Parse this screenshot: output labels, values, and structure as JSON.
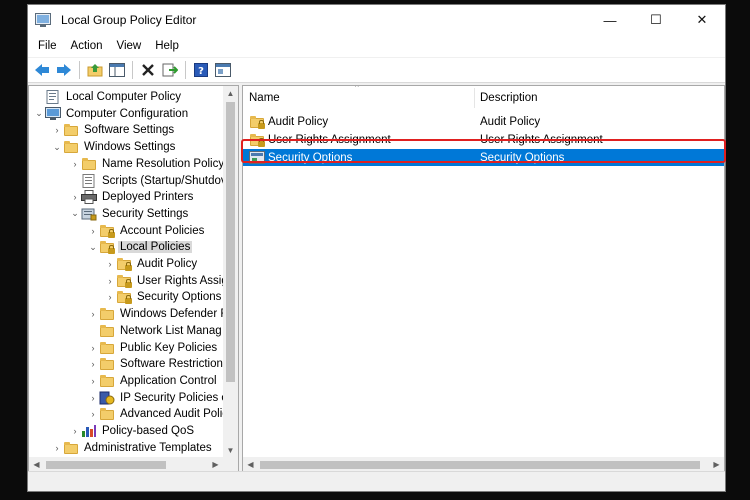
{
  "window": {
    "title": "Local Group Policy Editor",
    "controls": {
      "minimize": "—",
      "maximize": "☐",
      "close": "✕"
    }
  },
  "menu": [
    "File",
    "Action",
    "View",
    "Help"
  ],
  "toolbar": [
    "back-icon",
    "forward-icon",
    "up-folder-icon",
    "show-tree-icon",
    "delete-icon",
    "export-icon",
    "help-icon",
    "properties-icon"
  ],
  "tree": [
    {
      "label": "Local Computer Policy",
      "icon": "computer-policy-icon",
      "expander": ""
    },
    {
      "label": "Computer Configuration",
      "icon": "computer-icon",
      "expander": "⌄"
    },
    {
      "label": "Software Settings",
      "icon": "folder-icon",
      "expander": "›"
    },
    {
      "label": "Windows Settings",
      "icon": "folder-icon",
      "expander": "⌄"
    },
    {
      "label": "Name Resolution Policy",
      "icon": "folder-icon",
      "expander": "›"
    },
    {
      "label": "Scripts (Startup/Shutdov",
      "icon": "script-icon",
      "expander": ""
    },
    {
      "label": "Deployed Printers",
      "icon": "printer-icon",
      "expander": "›"
    },
    {
      "label": "Security Settings",
      "icon": "security-settings-icon",
      "expander": "⌄"
    },
    {
      "label": "Account Policies",
      "icon": "locked-folder-icon",
      "expander": "›"
    },
    {
      "label": "Local Policies",
      "icon": "locked-folder-icon",
      "expander": "⌄"
    },
    {
      "label": "Audit Policy",
      "icon": "locked-folder-icon",
      "expander": "›"
    },
    {
      "label": "User Rights Assig",
      "icon": "locked-folder-icon",
      "expander": "›"
    },
    {
      "label": "Security Options",
      "icon": "locked-folder-icon",
      "expander": "›"
    },
    {
      "label": "Windows Defender F",
      "icon": "folder-icon",
      "expander": "›"
    },
    {
      "label": "Network List Manag",
      "icon": "folder-icon",
      "expander": ""
    },
    {
      "label": "Public Key Policies",
      "icon": "folder-icon",
      "expander": "›"
    },
    {
      "label": "Software Restriction",
      "icon": "folder-icon",
      "expander": "›"
    },
    {
      "label": "Application Control",
      "icon": "folder-icon",
      "expander": "›"
    },
    {
      "label": "IP Security Policies o",
      "icon": "ip-security-icon",
      "expander": "›"
    },
    {
      "label": "Advanced Audit Polic",
      "icon": "folder-icon",
      "expander": "›"
    },
    {
      "label": "Policy-based QoS",
      "icon": "qos-chart-icon",
      "expander": "›"
    },
    {
      "label": "Administrative Templates",
      "icon": "folder-icon",
      "expander": "›"
    }
  ],
  "list": {
    "columns": [
      "Name",
      "Description"
    ],
    "rows": [
      {
        "name": "Audit Policy",
        "description": "Audit Policy",
        "icon": "locked-folder-icon"
      },
      {
        "name": "User Rights Assignment",
        "description": "User Rights Assignment",
        "icon": "locked-folder-icon"
      },
      {
        "name": "Security Options",
        "description": "Security Options",
        "icon": "security-options-icon"
      }
    ]
  },
  "colors": {
    "selection": "#0078d7",
    "highlight_border": "#e02020",
    "folder": "#f3cd6a"
  }
}
